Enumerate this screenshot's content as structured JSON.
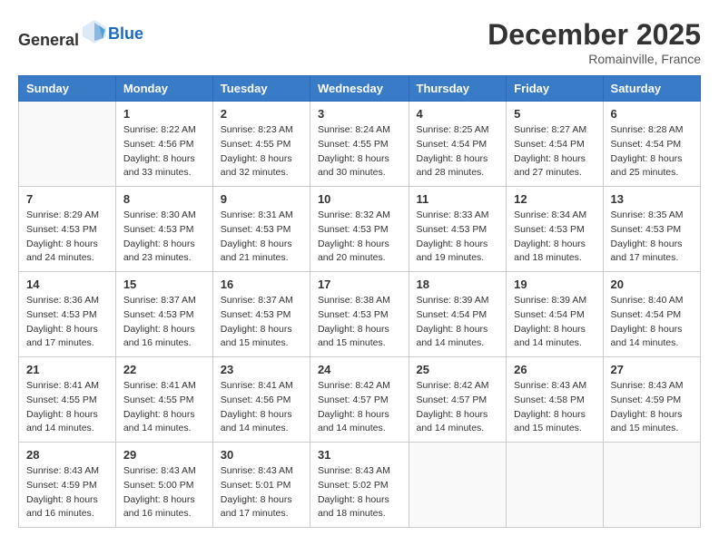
{
  "logo": {
    "text_general": "General",
    "text_blue": "Blue"
  },
  "header": {
    "month": "December 2025",
    "location": "Romainville, France"
  },
  "weekdays": [
    "Sunday",
    "Monday",
    "Tuesday",
    "Wednesday",
    "Thursday",
    "Friday",
    "Saturday"
  ],
  "weeks": [
    [
      {
        "day": "",
        "info": ""
      },
      {
        "day": "1",
        "info": "Sunrise: 8:22 AM\nSunset: 4:56 PM\nDaylight: 8 hours\nand 33 minutes."
      },
      {
        "day": "2",
        "info": "Sunrise: 8:23 AM\nSunset: 4:55 PM\nDaylight: 8 hours\nand 32 minutes."
      },
      {
        "day": "3",
        "info": "Sunrise: 8:24 AM\nSunset: 4:55 PM\nDaylight: 8 hours\nand 30 minutes."
      },
      {
        "day": "4",
        "info": "Sunrise: 8:25 AM\nSunset: 4:54 PM\nDaylight: 8 hours\nand 28 minutes."
      },
      {
        "day": "5",
        "info": "Sunrise: 8:27 AM\nSunset: 4:54 PM\nDaylight: 8 hours\nand 27 minutes."
      },
      {
        "day": "6",
        "info": "Sunrise: 8:28 AM\nSunset: 4:54 PM\nDaylight: 8 hours\nand 25 minutes."
      }
    ],
    [
      {
        "day": "7",
        "info": "Sunrise: 8:29 AM\nSunset: 4:53 PM\nDaylight: 8 hours\nand 24 minutes."
      },
      {
        "day": "8",
        "info": "Sunrise: 8:30 AM\nSunset: 4:53 PM\nDaylight: 8 hours\nand 23 minutes."
      },
      {
        "day": "9",
        "info": "Sunrise: 8:31 AM\nSunset: 4:53 PM\nDaylight: 8 hours\nand 21 minutes."
      },
      {
        "day": "10",
        "info": "Sunrise: 8:32 AM\nSunset: 4:53 PM\nDaylight: 8 hours\nand 20 minutes."
      },
      {
        "day": "11",
        "info": "Sunrise: 8:33 AM\nSunset: 4:53 PM\nDaylight: 8 hours\nand 19 minutes."
      },
      {
        "day": "12",
        "info": "Sunrise: 8:34 AM\nSunset: 4:53 PM\nDaylight: 8 hours\nand 18 minutes."
      },
      {
        "day": "13",
        "info": "Sunrise: 8:35 AM\nSunset: 4:53 PM\nDaylight: 8 hours\nand 17 minutes."
      }
    ],
    [
      {
        "day": "14",
        "info": "Sunrise: 8:36 AM\nSunset: 4:53 PM\nDaylight: 8 hours\nand 17 minutes."
      },
      {
        "day": "15",
        "info": "Sunrise: 8:37 AM\nSunset: 4:53 PM\nDaylight: 8 hours\nand 16 minutes."
      },
      {
        "day": "16",
        "info": "Sunrise: 8:37 AM\nSunset: 4:53 PM\nDaylight: 8 hours\nand 15 minutes."
      },
      {
        "day": "17",
        "info": "Sunrise: 8:38 AM\nSunset: 4:53 PM\nDaylight: 8 hours\nand 15 minutes."
      },
      {
        "day": "18",
        "info": "Sunrise: 8:39 AM\nSunset: 4:54 PM\nDaylight: 8 hours\nand 14 minutes."
      },
      {
        "day": "19",
        "info": "Sunrise: 8:39 AM\nSunset: 4:54 PM\nDaylight: 8 hours\nand 14 minutes."
      },
      {
        "day": "20",
        "info": "Sunrise: 8:40 AM\nSunset: 4:54 PM\nDaylight: 8 hours\nand 14 minutes."
      }
    ],
    [
      {
        "day": "21",
        "info": "Sunrise: 8:41 AM\nSunset: 4:55 PM\nDaylight: 8 hours\nand 14 minutes."
      },
      {
        "day": "22",
        "info": "Sunrise: 8:41 AM\nSunset: 4:55 PM\nDaylight: 8 hours\nand 14 minutes."
      },
      {
        "day": "23",
        "info": "Sunrise: 8:41 AM\nSunset: 4:56 PM\nDaylight: 8 hours\nand 14 minutes."
      },
      {
        "day": "24",
        "info": "Sunrise: 8:42 AM\nSunset: 4:57 PM\nDaylight: 8 hours\nand 14 minutes."
      },
      {
        "day": "25",
        "info": "Sunrise: 8:42 AM\nSunset: 4:57 PM\nDaylight: 8 hours\nand 14 minutes."
      },
      {
        "day": "26",
        "info": "Sunrise: 8:43 AM\nSunset: 4:58 PM\nDaylight: 8 hours\nand 15 minutes."
      },
      {
        "day": "27",
        "info": "Sunrise: 8:43 AM\nSunset: 4:59 PM\nDaylight: 8 hours\nand 15 minutes."
      }
    ],
    [
      {
        "day": "28",
        "info": "Sunrise: 8:43 AM\nSunset: 4:59 PM\nDaylight: 8 hours\nand 16 minutes."
      },
      {
        "day": "29",
        "info": "Sunrise: 8:43 AM\nSunset: 5:00 PM\nDaylight: 8 hours\nand 16 minutes."
      },
      {
        "day": "30",
        "info": "Sunrise: 8:43 AM\nSunset: 5:01 PM\nDaylight: 8 hours\nand 17 minutes."
      },
      {
        "day": "31",
        "info": "Sunrise: 8:43 AM\nSunset: 5:02 PM\nDaylight: 8 hours\nand 18 minutes."
      },
      {
        "day": "",
        "info": ""
      },
      {
        "day": "",
        "info": ""
      },
      {
        "day": "",
        "info": ""
      }
    ]
  ]
}
